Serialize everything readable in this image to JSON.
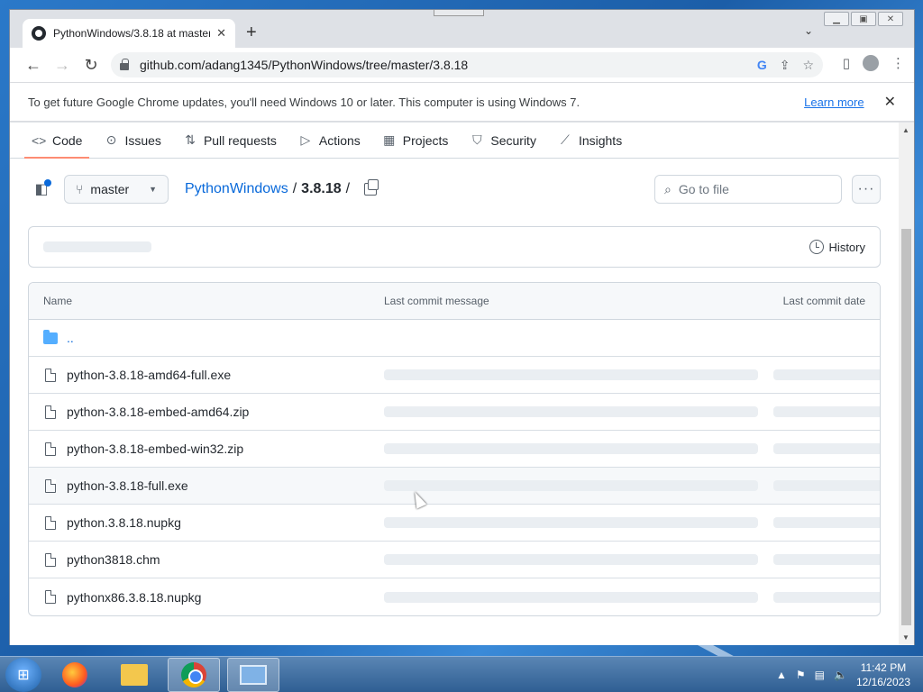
{
  "browser": {
    "tab_title": "PythonWindows/3.8.18 at master",
    "tab_close": "✕",
    "new_tab": "+",
    "url": "github.com/adang1345/PythonWindows/tree/master/3.8.18"
  },
  "infobar": {
    "message": "To get future Google Chrome updates, you'll need Windows 10 or later. This computer is using Windows 7.",
    "learn_more": "Learn more",
    "close": "✕"
  },
  "repo_nav": {
    "tabs": [
      {
        "label": "Code",
        "icon": "code-icon"
      },
      {
        "label": "Issues",
        "icon": "issue-icon"
      },
      {
        "label": "Pull requests",
        "icon": "pull-request-icon"
      },
      {
        "label": "Actions",
        "icon": "play-icon"
      },
      {
        "label": "Projects",
        "icon": "table-icon"
      },
      {
        "label": "Security",
        "icon": "shield-icon"
      },
      {
        "label": "Insights",
        "icon": "graph-icon"
      }
    ]
  },
  "breadcrumb": {
    "branch": "master",
    "repo": "PythonWindows",
    "sep": "/",
    "folder": "3.8.18",
    "trail": "/"
  },
  "search": {
    "placeholder": "Go to file"
  },
  "commit_box": {
    "history_label": "History"
  },
  "file_table": {
    "headers": [
      "Name",
      "Last commit message",
      "Last commit date"
    ],
    "parent_dir": "..",
    "files": [
      "python-3.8.18-amd64-full.exe",
      "python-3.8.18-embed-amd64.zip",
      "python-3.8.18-embed-win32.zip",
      "python-3.8.18-full.exe",
      "python.3.8.18.nupkg",
      "python3818.chm",
      "pythonx86.3.8.18.nupkg"
    ]
  },
  "taskbar": {
    "time": "11:42 PM",
    "date": "12/16/2023"
  },
  "colors": {
    "link": "#0969da",
    "active_tab_underline": "#fd8c73",
    "folder_icon": "#54aeff"
  }
}
